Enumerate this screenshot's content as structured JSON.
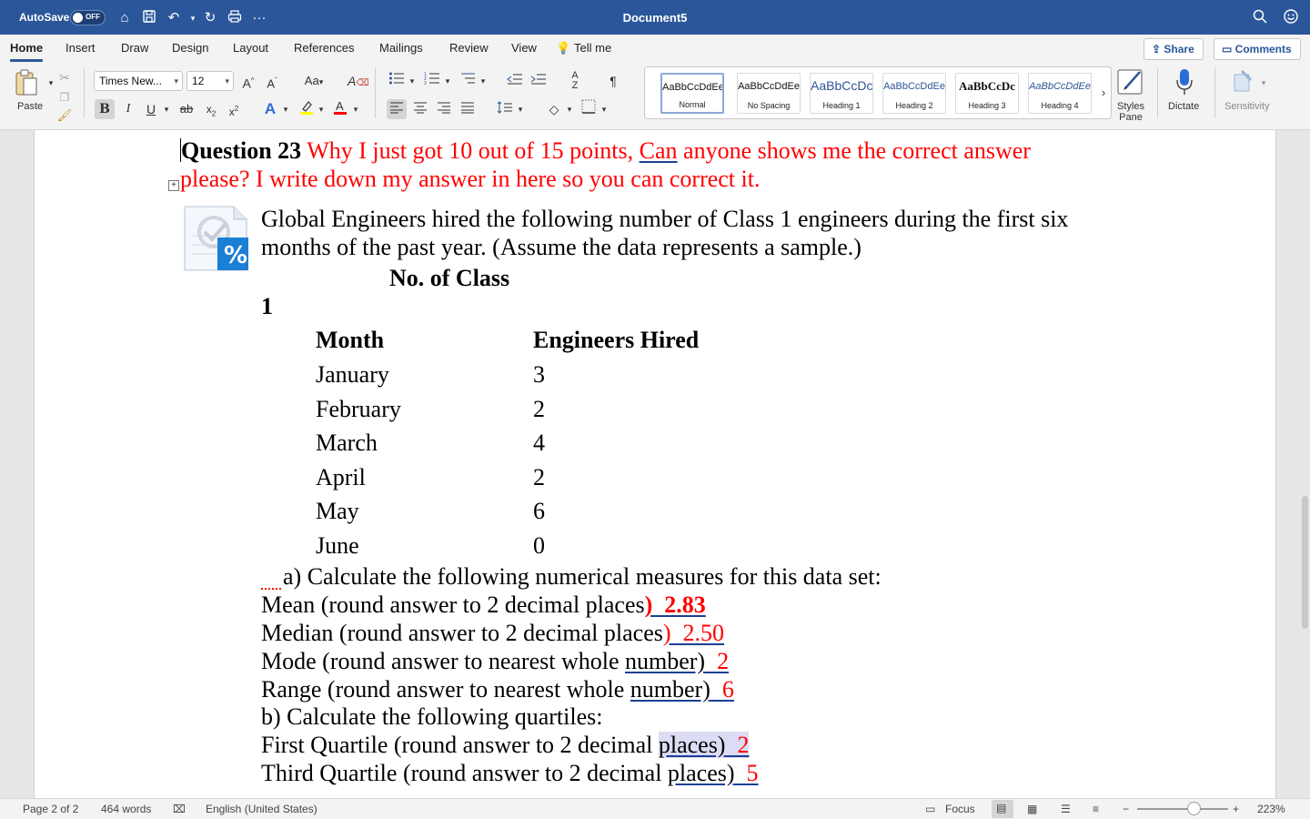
{
  "titlebar": {
    "autosave_label": "AutoSave",
    "autosave_state": "OFF",
    "document_title": "Document5"
  },
  "tabs": {
    "items": [
      "Home",
      "Insert",
      "Draw",
      "Design",
      "Layout",
      "References",
      "Mailings",
      "Review",
      "View"
    ],
    "tell_me": "Tell me",
    "share": "Share",
    "comments": "Comments"
  },
  "ribbon": {
    "paste_label": "Paste",
    "font_name": "Times New...",
    "font_size": "12",
    "styles": [
      {
        "preview": "AaBbCcDdEe",
        "name": "Normal"
      },
      {
        "preview": "AaBbCcDdEe",
        "name": "No Spacing"
      },
      {
        "preview": "AaBbCcDc",
        "name": "Heading 1"
      },
      {
        "preview": "AaBbCcDdEe",
        "name": "Heading 2"
      },
      {
        "preview": "AaBbCcDc",
        "name": "Heading 3"
      },
      {
        "preview": "AaBbCcDdEe",
        "name": "Heading 4"
      }
    ],
    "styles_pane_label": "Styles\nPane",
    "dictate_label": "Dictate",
    "sensitivity_label": "Sensitivity",
    "colors": {
      "highlight": "#ffff00",
      "font_color": "#ff0000"
    }
  },
  "document": {
    "question_number": "Question 23",
    "question_text_1": " Why I just got 10 out of 15 points, ",
    "question_text_can": "Can",
    "question_text_2": " anyone shows me the correct answer",
    "question_text_3": "please? I write down my answer in here so you can correct it.",
    "intro_1": "Global Engineers hired the following number of Class 1 engineers during the first six",
    "intro_2": "months of the past year. (Assume the data represents a sample.)",
    "header_no_of_class": "No. of Class",
    "header_one": "1",
    "table": {
      "col_month": "Month",
      "col_hired": "Engineers Hired",
      "rows": [
        {
          "month": "January",
          "hired": "3"
        },
        {
          "month": "February",
          "hired": "2"
        },
        {
          "month": "March",
          "hired": "4"
        },
        {
          "month": "April",
          "hired": "2"
        },
        {
          "month": "May",
          "hired": "6"
        },
        {
          "month": "June",
          "hired": "0"
        }
      ]
    },
    "part_a": "a) Calculate the following numerical measures for this data set:",
    "mean_label": "Mean (round answer to 2 decimal places",
    "mean_answer": ")  2.83",
    "median_label": "Median (round answer to 2 decimal places",
    "median_answer": ")  2.50",
    "mode_label": "Mode (round answer to nearest whole ",
    "mode_u": "number)",
    "mode_answer": "  2",
    "range_label": "Range (round answer to nearest whole ",
    "range_u": "number)",
    "range_answer": "  6",
    "part_b": "b) Calculate the following quartiles:",
    "q1_label": "First Quartile (round answer to 2 decimal ",
    "q1_u": "places)",
    "q1_answer": "  2",
    "q3_label": "Third Quartile (round answer to 2 decimal ",
    "q3_u": "places)",
    "q3_answer": "  5"
  },
  "statusbar": {
    "page": "Page 2 of 2",
    "words": "464 words",
    "language": "English (United States)",
    "focus": "Focus",
    "zoom": "223%"
  }
}
